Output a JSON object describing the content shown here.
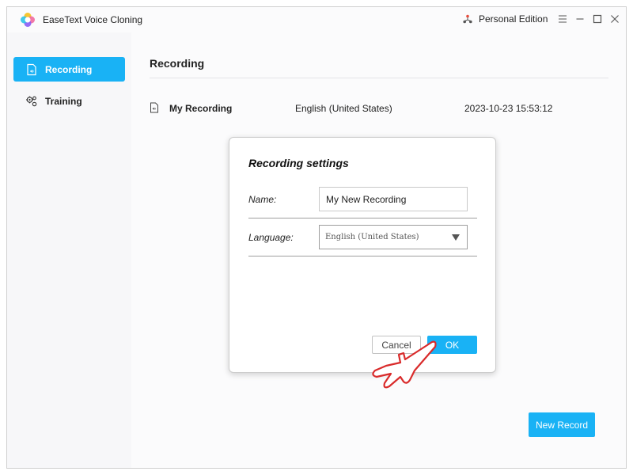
{
  "app": {
    "title": "EaseText Voice Cloning",
    "edition": "Personal Edition",
    "icons": {
      "logo": "app-logo-icon",
      "edition": "network-icon",
      "menu": "menu-icon",
      "minimize": "minimize-icon",
      "maximize": "maximize-icon",
      "close": "close-icon"
    }
  },
  "sidebar": {
    "items": [
      {
        "label": "Recording",
        "icon": "audio-file-icon",
        "active": true
      },
      {
        "label": "Training",
        "icon": "gears-icon",
        "active": false
      }
    ]
  },
  "main": {
    "title": "Recording",
    "recordings": [
      {
        "name": "My Recording",
        "language": "English (United States)",
        "date": "2023-10-23 15:53:12"
      }
    ],
    "new_record_label": "New Record"
  },
  "dialog": {
    "title": "Recording settings",
    "name_label": "Name:",
    "name_value": "My New Recording",
    "language_label": "Language:",
    "language_value": "English (United States)",
    "cancel_label": "Cancel",
    "ok_label": "OK"
  },
  "colors": {
    "accent": "#19b2f5",
    "cursor_outline": "#d92b2b"
  }
}
